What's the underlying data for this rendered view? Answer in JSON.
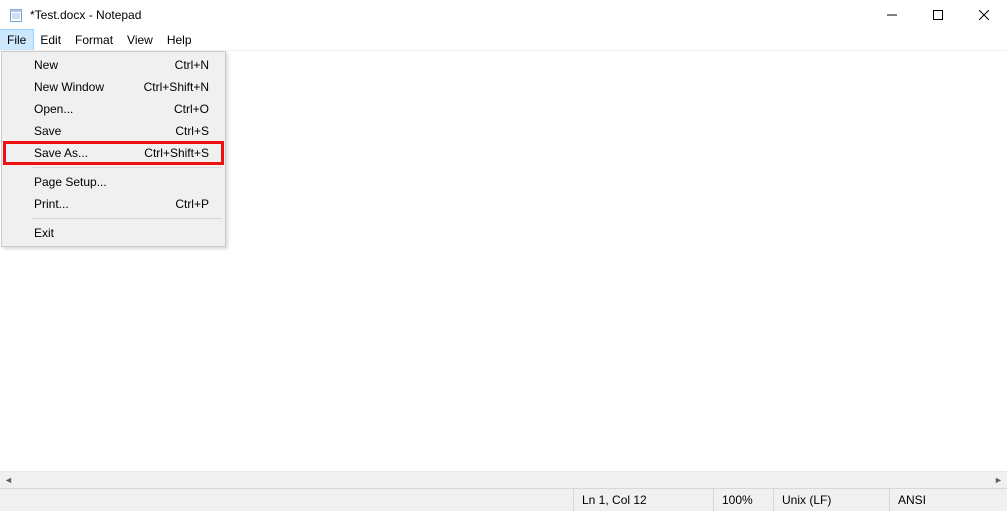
{
  "titlebar": {
    "title": "*Test.docx - Notepad"
  },
  "menubar": {
    "items": [
      "File",
      "Edit",
      "Format",
      "View",
      "Help"
    ],
    "open_index": 0
  },
  "file_menu": {
    "groups": [
      [
        {
          "label": "New",
          "shortcut": "Ctrl+N"
        },
        {
          "label": "New Window",
          "shortcut": "Ctrl+Shift+N"
        },
        {
          "label": "Open...",
          "shortcut": "Ctrl+O"
        },
        {
          "label": "Save",
          "shortcut": "Ctrl+S"
        },
        {
          "label": "Save As...",
          "shortcut": "Ctrl+Shift+S",
          "highlight": true
        }
      ],
      [
        {
          "label": "Page Setup...",
          "shortcut": ""
        },
        {
          "label": "Print...",
          "shortcut": "Ctrl+P"
        }
      ],
      [
        {
          "label": "Exit",
          "shortcut": ""
        }
      ]
    ]
  },
  "statusbar": {
    "position": "Ln 1, Col 12",
    "zoom": "100%",
    "eol": "Unix (LF)",
    "encoding": "ANSI"
  }
}
